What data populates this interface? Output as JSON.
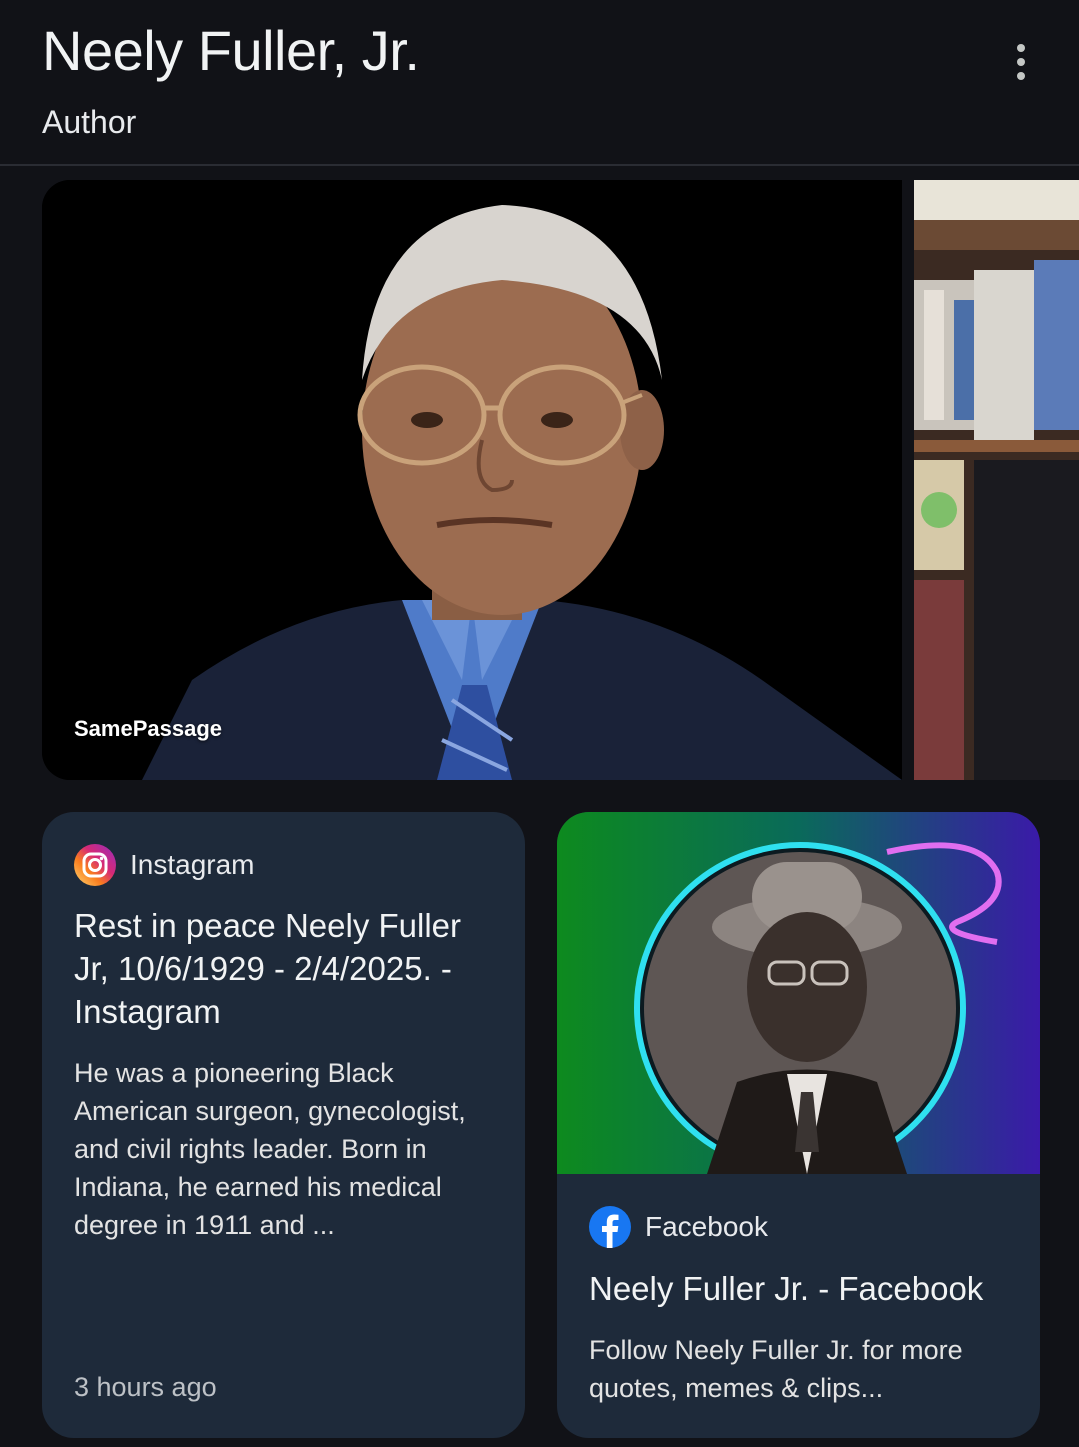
{
  "header": {
    "title": "Neely Fuller, Jr.",
    "subtitle": "Author",
    "more_icon": "more-vert-icon"
  },
  "images": {
    "main_source": "SamePassage"
  },
  "cards": [
    {
      "source": "Instagram",
      "source_icon": "instagram-icon",
      "title": "Rest in peace Neely Fuller Jr, 10/6/1929 - 2/4/2025. - Instagram",
      "snippet": "He was a pioneering Black American surgeon, gynecologist, and civil rights leader. Born in Indiana, he earned his medical degree in 1911 and ...",
      "time": "3 hours ago"
    },
    {
      "source": "Facebook",
      "source_icon": "facebook-icon",
      "title": "Neely Fuller Jr. - Facebook",
      "snippet": "Follow Neely Fuller Jr. for more quotes, memes & clips..."
    }
  ],
  "colors": {
    "background": "#111217",
    "card": "#1e2a3a",
    "text": "#e8eaed"
  }
}
